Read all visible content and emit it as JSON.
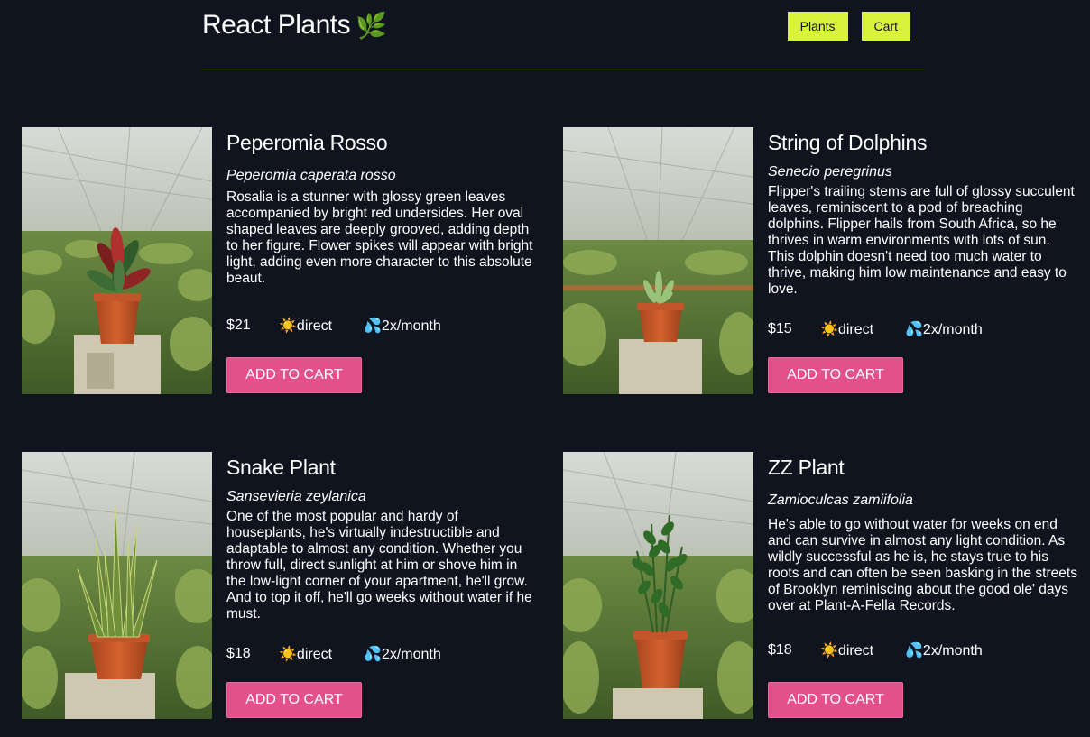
{
  "header": {
    "title": "React Plants",
    "leaf_glyph": "🌿",
    "nav": [
      {
        "label": "Plants",
        "active": true
      },
      {
        "label": "Cart",
        "active": false
      }
    ]
  },
  "cta_label": "ADD TO CART",
  "icons": {
    "sun": "☀️",
    "water": "💦"
  },
  "plants": [
    {
      "name": "Peperomia Rosso",
      "latin": "Peperomia caperata rosso",
      "description": "Rosalia is a stunner with glossy green leaves accompanied by bright red undersides. Her oval shaped leaves are deeply grooved, adding depth to her figure. Flower spikes will appear with bright light, adding even more character to this absolute beaut.",
      "price": "$21",
      "light": "direct",
      "water": "2x/month",
      "plant_type": "peperomia"
    },
    {
      "name": "String of Dolphins",
      "latin": "Senecio peregrinus",
      "description": "Flipper's trailing stems are full of glossy succulent leaves, reminiscent to a pod of breaching dolphins. Flipper hails from South Africa, so he thrives in warm environments with lots of sun. This dolphin doesn't need too much water to thrive, making him low maintenance and easy to love.",
      "price": "$15",
      "light": "direct",
      "water": "2x/month",
      "plant_type": "succulent"
    },
    {
      "name": "Snake Plant",
      "latin": "Sansevieria zeylanica",
      "description": "One of the most popular and hardy of houseplants, he's virtually indestructible and adaptable to almost any condition. Whether you throw full, direct sunlight at him or shove him in the low-light corner of your apartment, he'll grow. And to top it off, he'll go weeks without water if he must.",
      "price": "$18",
      "light": "direct",
      "water": "2x/month",
      "plant_type": "snake"
    },
    {
      "name": "ZZ Plant",
      "latin": "Zamioculcas zamiifolia",
      "description": "He's able to go without water for weeks on end and can survive in almost any light condition. As wildly successful as he is, he stays true to his roots and can often be seen basking in the streets of Brooklyn reminiscing about the good ole' days over at Plant-A-Fella Records.",
      "price": "$18",
      "light": "direct",
      "water": "2x/month",
      "plant_type": "zz"
    }
  ]
}
